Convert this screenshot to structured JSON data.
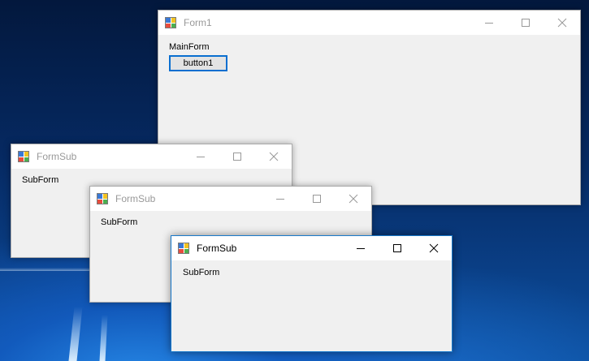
{
  "form1": {
    "title": "Form1",
    "label": "MainForm",
    "button_label": "button1"
  },
  "subforms": [
    {
      "title": "FormSub",
      "label": "SubForm",
      "state": "inactive"
    },
    {
      "title": "FormSub",
      "label": "SubForm",
      "state": "inactive"
    },
    {
      "title": "FormSub",
      "label": "SubForm",
      "state": "active"
    }
  ],
  "icons": {
    "app": "winforms-app-icon",
    "minimize": "minimize-icon",
    "maximize": "maximize-icon",
    "close": "close-icon"
  }
}
